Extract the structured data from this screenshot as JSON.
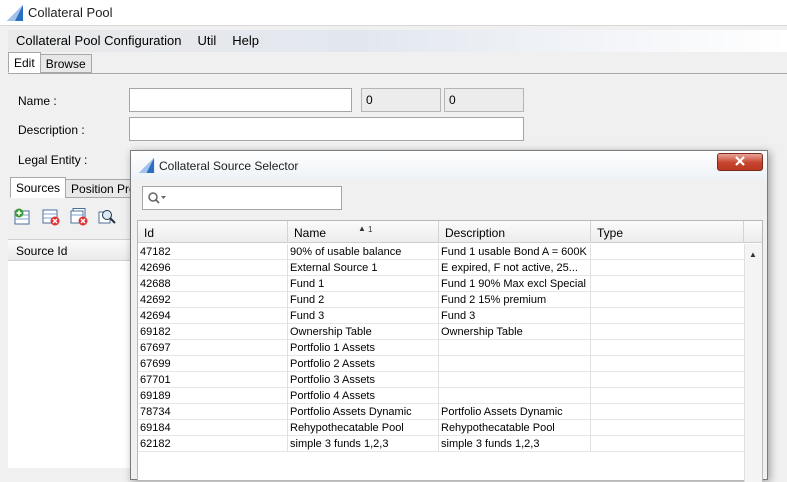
{
  "window": {
    "title": "Collateral Pool"
  },
  "menu": [
    "Collateral Pool Configuration",
    "Util",
    "Help"
  ],
  "top_tabs": [
    {
      "label": "Edit",
      "active": true
    },
    {
      "label": "Browse",
      "active": false
    }
  ],
  "form": {
    "name_label": "Name :",
    "name_value": "",
    "ro_value_1": "0",
    "ro_value_2": "0",
    "description_label": "Description :",
    "description_value": "",
    "legal_entity_label": "Legal Entity :"
  },
  "sub_tabs": [
    {
      "label": "Sources",
      "active": true
    },
    {
      "label": "Position Previ",
      "active": false
    }
  ],
  "toolbar_icons": [
    "add-source-icon",
    "remove-source-icon",
    "remove-all-icon",
    "search-source-icon"
  ],
  "left_grid": {
    "header": "Source Id"
  },
  "dialog": {
    "title": "Collateral Source Selector",
    "search_value": "",
    "columns": [
      "Id",
      "Name",
      "Description",
      "Type"
    ],
    "sort_indicator": "1",
    "rows": [
      {
        "id": "47182",
        "name": "90% of usable balance",
        "description": "Fund 1 usable Bond A = 600K",
        "type": ""
      },
      {
        "id": "42696",
        "name": "External Source 1",
        "description": "E expired, F not active, 25...",
        "type": ""
      },
      {
        "id": "42688",
        "name": "Fund 1",
        "description": "Fund 1 90% Max excl Special",
        "type": ""
      },
      {
        "id": "42692",
        "name": "Fund 2",
        "description": "Fund 2 15% premium",
        "type": ""
      },
      {
        "id": "42694",
        "name": "Fund 3",
        "description": "Fund 3",
        "type": ""
      },
      {
        "id": "69182",
        "name": "Ownership Table",
        "description": "Ownership Table",
        "type": ""
      },
      {
        "id": "67697",
        "name": "Portfolio 1 Assets",
        "description": "",
        "type": ""
      },
      {
        "id": "67699",
        "name": "Portfolio 2 Assets",
        "description": "",
        "type": ""
      },
      {
        "id": "67701",
        "name": "Portfolio 3 Assets",
        "description": "",
        "type": ""
      },
      {
        "id": "69189",
        "name": "Portfolio 4 Assets",
        "description": "",
        "type": ""
      },
      {
        "id": "78734",
        "name": "Portfolio Assets Dynamic",
        "description": "Portfolio Assets Dynamic",
        "type": ""
      },
      {
        "id": "69184",
        "name": "Rehypothecatable Pool",
        "description": "Rehypothecatable Pool",
        "type": ""
      },
      {
        "id": "62182",
        "name": "simple 3 funds 1,2,3",
        "description": "simple 3 funds 1,2,3",
        "type": ""
      }
    ]
  },
  "colors": {
    "close_button": "#c7432e",
    "accent": "#1f5fa8"
  }
}
